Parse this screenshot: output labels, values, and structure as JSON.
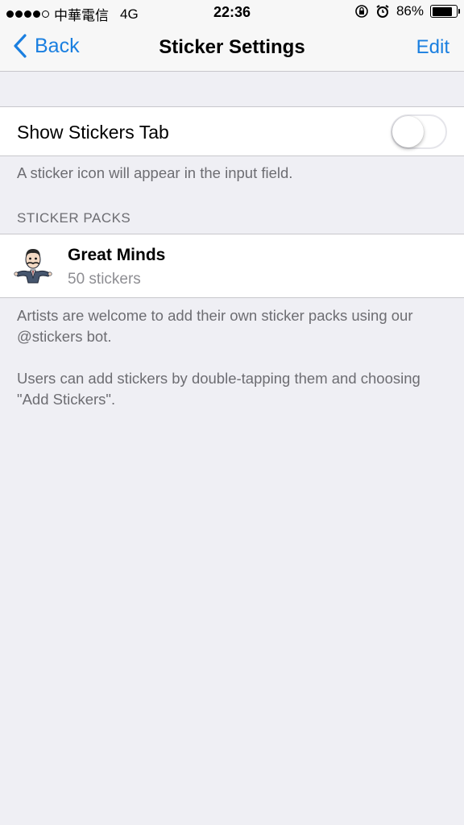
{
  "status": {
    "carrier": "中華電信",
    "network": "4G",
    "time": "22:36",
    "battery": "86%",
    "battery_level": 0.86
  },
  "nav": {
    "back_label": "Back",
    "title": "Sticker Settings",
    "edit_label": "Edit",
    "accent_color": "#1a7fe0"
  },
  "settings": {
    "show_tab_label": "Show Stickers Tab",
    "show_tab_enabled": false,
    "show_tab_footer": "A sticker icon will appear in the input field."
  },
  "sticker_packs": {
    "header": "STICKER PACKS",
    "items": [
      {
        "name": "Great Minds",
        "count": "50 stickers",
        "icon": "cartoon-man-sticker-icon"
      }
    ],
    "footer_1": "Artists are welcome to add their own sticker packs using our @stickers bot.",
    "footer_2": "Users can add stickers by double-tapping them and choosing \"Add Stickers\"."
  }
}
